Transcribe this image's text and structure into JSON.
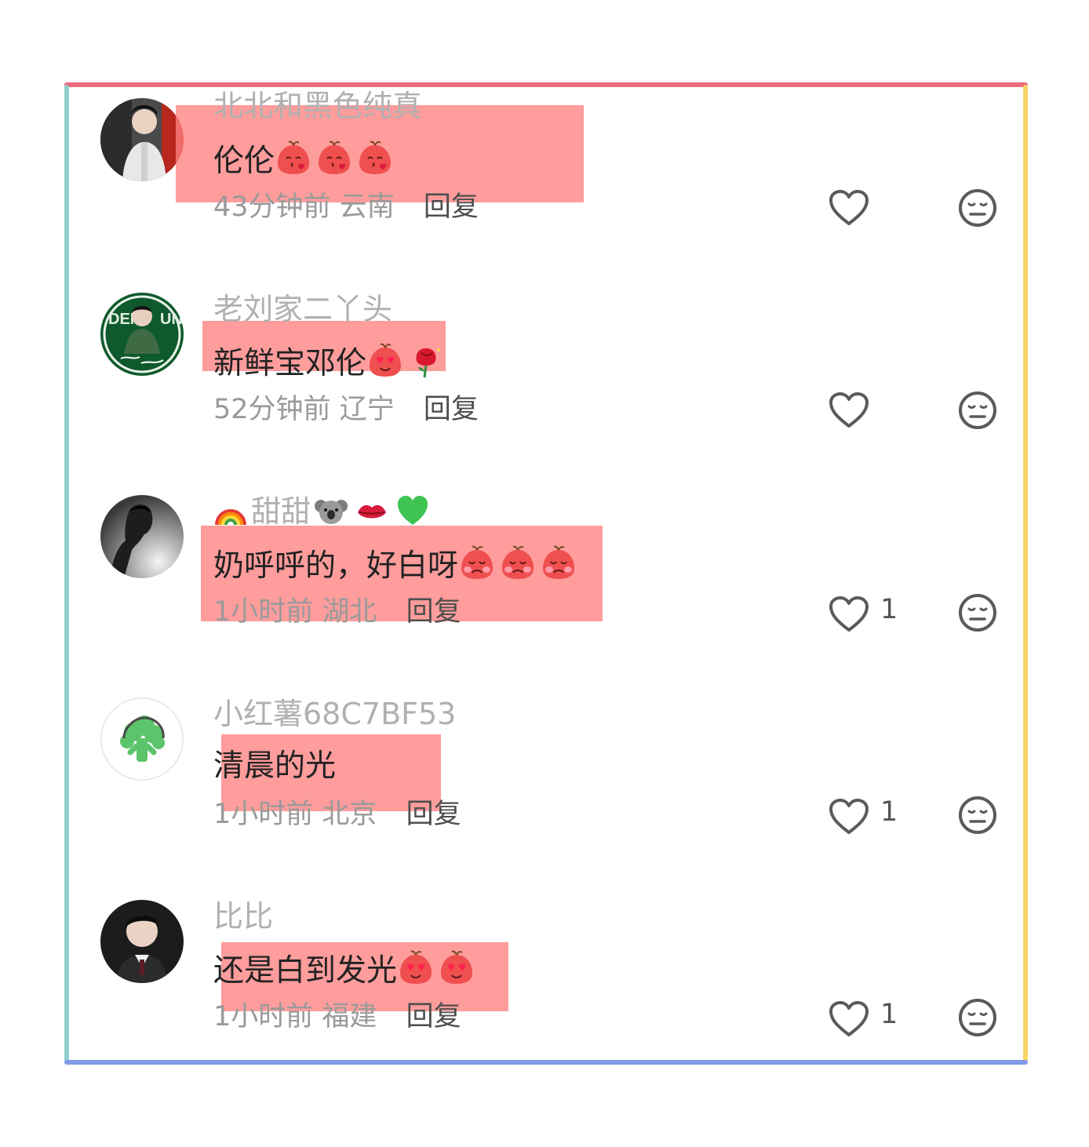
{
  "comments": [
    {
      "username": "北北和黑色纯真",
      "text": "伦伦",
      "emojis": [
        "kiss-bean-emoji",
        "kiss-bean-emoji",
        "kiss-bean-emoji"
      ],
      "time": "43分钟前",
      "location": "云南",
      "reply_label": "回复",
      "likes": ""
    },
    {
      "username": "老刘家二丫头",
      "text": "新鲜宝邓伦",
      "emojis": [
        "heart-eyes-bean-emoji",
        "rose-emoji"
      ],
      "time": "52分钟前",
      "location": "辽宁",
      "reply_label": "回复",
      "likes": ""
    },
    {
      "username": "甜甜",
      "username_emojis": [
        "rainbow-emoji",
        "koala-emoji",
        "kiss-mark-emoji",
        "green-heart-emoji"
      ],
      "text": "奶呼呼的，好白呀",
      "emojis": [
        "shy-bean-emoji",
        "shy-bean-emoji",
        "shy-bean-emoji"
      ],
      "time": "1小时前",
      "location": "湖北",
      "reply_label": "回复",
      "likes": "1"
    },
    {
      "username": "小红薯68C7BF53",
      "text": "清晨的光",
      "emojis": [],
      "time": "1小时前",
      "location": "北京",
      "reply_label": "回复",
      "likes": "1"
    },
    {
      "username": "比比",
      "text": "还是白到发光",
      "emojis": [
        "heart-eyes-bean-emoji",
        "heart-eyes-bean-emoji"
      ],
      "time": "1小时前",
      "location": "福建",
      "reply_label": "回复",
      "likes": "1"
    }
  ],
  "colors": {
    "frame_top": "#ec6a7c",
    "frame_left": "#8fd0cc",
    "frame_right": "#f9d464",
    "frame_bottom": "#7f9ae6",
    "highlight": "#ff8080",
    "username": "#b0b0b0",
    "meta": "#9a9a9a"
  }
}
